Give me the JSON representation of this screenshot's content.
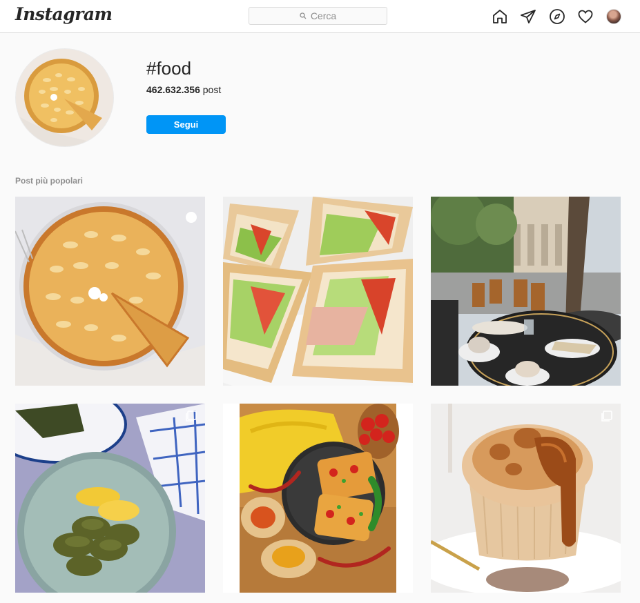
{
  "header": {
    "logo_text": "Instagram",
    "search_placeholder": "Cerca",
    "icons": [
      "home-icon",
      "direct-send-icon",
      "explore-compass-icon",
      "activity-heart-icon",
      "profile-avatar"
    ]
  },
  "hashtag": {
    "title": "#food",
    "post_count": "462.632.356",
    "post_suffix": " post",
    "follow_label": "Segui"
  },
  "section": {
    "label": "Post più popolari"
  },
  "posts": [
    {
      "subject": "almond tart",
      "multiple": false
    },
    {
      "subject": "club sandwiches",
      "multiple": false
    },
    {
      "subject": "paris cafe terrace",
      "multiple": false
    },
    {
      "subject": "stuffed grape leaves",
      "multiple": true
    },
    {
      "subject": "pizza toast",
      "multiple": false
    },
    {
      "subject": "caramel muffin",
      "multiple": true
    }
  ],
  "colors": {
    "accent": "#0095f6",
    "background": "#fafafa",
    "border": "#dbdbdb"
  }
}
